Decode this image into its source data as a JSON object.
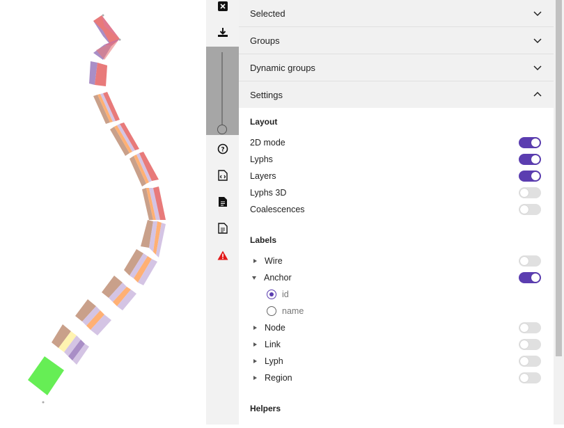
{
  "toolbar": {
    "buttons": [
      {
        "name": "close-icon"
      },
      {
        "name": "download-icon"
      },
      {
        "name": "help-icon"
      },
      {
        "name": "code-file-icon"
      },
      {
        "name": "document-icon"
      },
      {
        "name": "text-document-icon"
      },
      {
        "name": "warning-icon"
      }
    ],
    "warning_color": "#e21818"
  },
  "panel": {
    "sections": {
      "selected": "Selected",
      "groups": "Groups",
      "dynamic_groups": "Dynamic groups",
      "settings": "Settings"
    },
    "layout": {
      "title": "Layout",
      "items": [
        {
          "label": "2D mode",
          "on": true
        },
        {
          "label": "Lyphs",
          "on": true
        },
        {
          "label": "Layers",
          "on": true
        },
        {
          "label": "Lyphs 3D",
          "on": false
        },
        {
          "label": "Coalescences",
          "on": false
        }
      ]
    },
    "labels": {
      "title": "Labels",
      "wire": "Wire",
      "anchor": "Anchor",
      "anchor_options": [
        "id",
        "name"
      ],
      "anchor_selected": "id",
      "node": "Node",
      "link": "Link",
      "lyph": "Lyph",
      "region": "Region"
    },
    "helpers": {
      "title": "Helpers"
    }
  },
  "colors": {
    "accent": "#5b3db0",
    "toggle_off": "#e0e0e0",
    "header_bg": "#f1f1f1",
    "region_green": "#66ee55"
  }
}
